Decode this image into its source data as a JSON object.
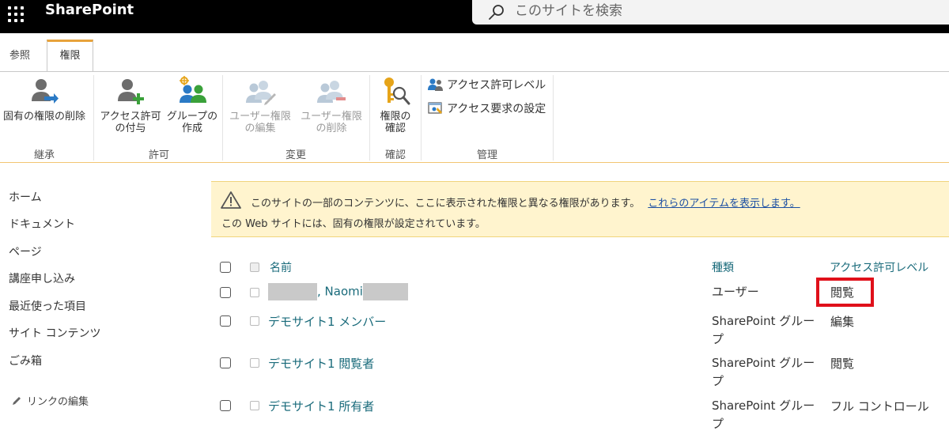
{
  "suitebar": {
    "brand": "SharePoint",
    "search_placeholder": "このサイトを検索"
  },
  "ribbon": {
    "tabs": [
      {
        "label": "参照"
      },
      {
        "label": "権限",
        "active": true
      }
    ],
    "groups": {
      "inherit": {
        "label": "継承",
        "buttons": [
          {
            "label_line1": "固有の権限の削除",
            "icon": "delete-unique-permissions-icon"
          }
        ]
      },
      "grant": {
        "label": "許可",
        "buttons": [
          {
            "label_line1": "アクセス許可",
            "label_line2": "の付与",
            "icon": "grant-permissions-icon"
          },
          {
            "label_line1": "グループの",
            "label_line2": "作成",
            "icon": "create-group-icon"
          }
        ]
      },
      "modify": {
        "label": "変更",
        "buttons": [
          {
            "label_line1": "ユーザー権限",
            "label_line2": "の編集",
            "icon": "edit-user-permissions-icon",
            "disabled": true
          },
          {
            "label_line1": "ユーザー権限",
            "label_line2": "の削除",
            "icon": "remove-user-permissions-icon",
            "disabled": true
          }
        ]
      },
      "check": {
        "label": "確認",
        "buttons": [
          {
            "label_line1": "権限の",
            "label_line2": "確認",
            "icon": "check-permissions-icon"
          }
        ]
      },
      "manage": {
        "label": "管理",
        "buttons": [
          {
            "label": "アクセス許可レベル",
            "icon": "permission-levels-icon"
          },
          {
            "label": "アクセス要求の設定",
            "icon": "access-request-settings-icon"
          }
        ]
      }
    }
  },
  "leftnav": {
    "items": [
      "ホーム",
      "ドキュメント",
      "ページ",
      "講座申し込み",
      "最近使った項目",
      "サイト コンテンツ",
      "ごみ箱"
    ],
    "edit_links": "リンクの編集"
  },
  "message": {
    "line1": "このサイトの一部のコンテンツに、ここに表示された権限と異なる権限があります。",
    "link": "これらのアイテムを表示します。",
    "line2": "この Web サイトには、固有の権限が設定されています。"
  },
  "table": {
    "headers": {
      "name": "名前",
      "type": "種類",
      "level": "アクセス許可レベル"
    },
    "rows": [
      {
        "name": ", Naomi",
        "type": "ユーザー",
        "level": "閲覧",
        "redacted": true
      },
      {
        "name": "デモサイト1 メンバー",
        "type": "SharePoint グループ",
        "level": "編集"
      },
      {
        "name": "デモサイト1 閲覧者",
        "type": "SharePoint グループ",
        "level": "閲覧"
      },
      {
        "name": "デモサイト1 所有者",
        "type": "SharePoint グループ",
        "level": "フル コントロール"
      }
    ]
  },
  "colors": {
    "suitebar": "#000000",
    "tab_accent": "#e8a33c",
    "message_bg": "#fff4ce",
    "link_teal": "#1a6b7b",
    "highlight_red": "#e0101a"
  }
}
